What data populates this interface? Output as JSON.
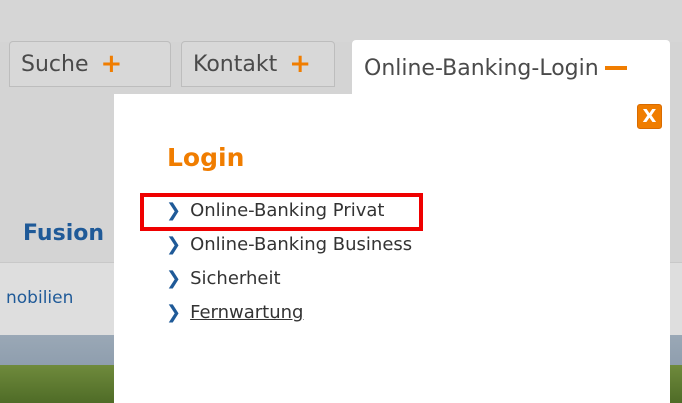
{
  "tabs": {
    "suche": "Suche",
    "kontakt": "Kontakt",
    "login": "Online-Banking-Login"
  },
  "nav": {
    "fusion": "Fusion",
    "immobilien": "nobilien"
  },
  "panel": {
    "title": "Login",
    "close_label": "X",
    "links": [
      {
        "label": "Online-Banking Privat"
      },
      {
        "label": "Online-Banking Business"
      },
      {
        "label": "Sicherheit"
      },
      {
        "label": "Fernwartung"
      }
    ]
  },
  "colors": {
    "accent": "#f07d00",
    "link_blue": "#1f5a98",
    "highlight": "#ef0000"
  },
  "icons": {
    "plus": "plus-icon",
    "minus": "minus-icon",
    "chevron": "chevron-right-icon",
    "close": "close-icon"
  }
}
